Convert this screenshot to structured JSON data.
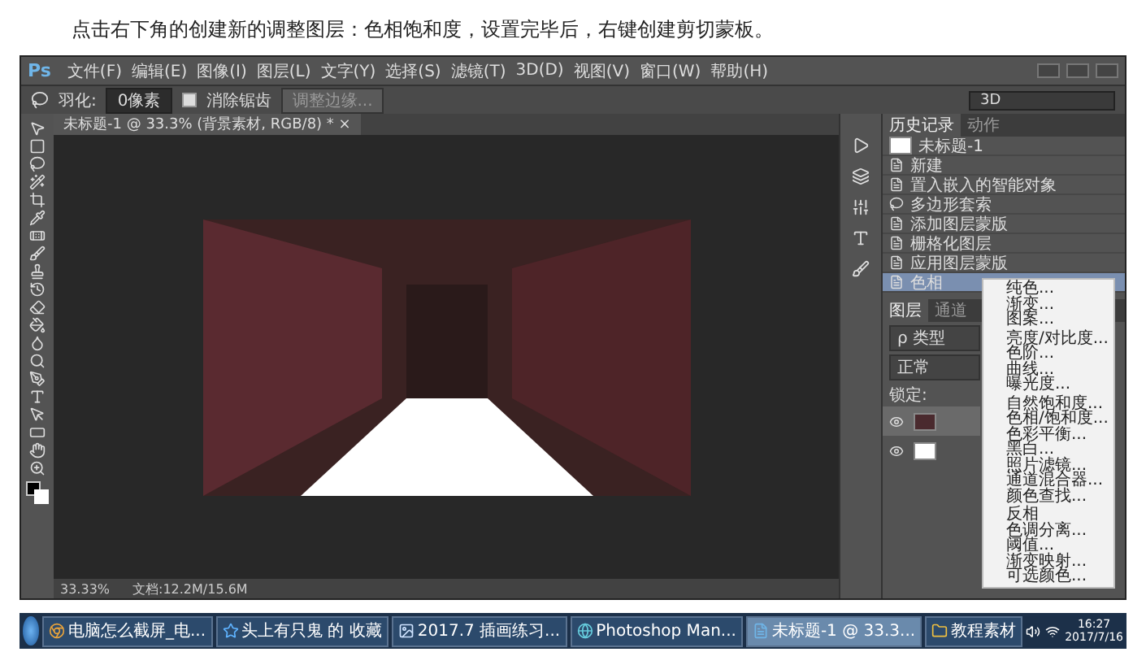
{
  "instruction": "点击右下角的创建新的调整图层：色相饱和度，设置完毕后，右键创建剪切蒙板。",
  "app": {
    "logo": "Ps",
    "menu": [
      "文件(F)",
      "编辑(E)",
      "图像(I)",
      "图层(L)",
      "文字(Y)",
      "选择(S)",
      "滤镜(T)",
      "3D(D)",
      "视图(V)",
      "窗口(W)",
      "帮助(H)"
    ]
  },
  "options_bar": {
    "feather_label": "羽化:",
    "feather_value": "0像素",
    "antialias": {
      "label": "消除锯齿",
      "checked": true
    },
    "refine_button": "调整边缘...",
    "workspace": "3D"
  },
  "document_tab": {
    "title": "未标题-1 @ 33.3% (背景素材, RGB/8) *",
    "close": "×"
  },
  "history_panel": {
    "tabs": [
      {
        "label": "历史记录",
        "selected": true
      },
      {
        "label": "动作",
        "selected": false
      }
    ],
    "items": [
      {
        "kind": "snapshot",
        "label": "未标题-1",
        "selected": false
      },
      {
        "kind": "step",
        "label": "新建",
        "selected": false
      },
      {
        "kind": "step",
        "label": "置入嵌入的智能对象",
        "selected": false
      },
      {
        "kind": "lasso",
        "label": "多边形套索",
        "selected": false
      },
      {
        "kind": "step",
        "label": "添加图层蒙版",
        "selected": false
      },
      {
        "kind": "step",
        "label": "栅格化图层",
        "selected": false
      },
      {
        "kind": "step",
        "label": "应用图层蒙版",
        "selected": false
      },
      {
        "kind": "step",
        "label": "色相",
        "selected": true
      }
    ]
  },
  "layers_panel": {
    "tabs": [
      {
        "label": "图层",
        "selected": true
      },
      {
        "label": "通道",
        "selected": false
      }
    ],
    "filter": "ρ 类型",
    "blend_mode": "正常",
    "lock_label": "锁定:",
    "layers": [
      {
        "kind": "image",
        "visible": true,
        "selected": true
      },
      {
        "kind": "white",
        "visible": true,
        "selected": false
      }
    ]
  },
  "context_menu": {
    "groups": [
      [
        "纯色...",
        "渐变...",
        "图案..."
      ],
      [
        "亮度/对比度...",
        "色阶...",
        "曲线...",
        "曝光度..."
      ],
      [
        "自然饱和度...",
        "色相/饱和度...",
        "色彩平衡...",
        "黑白...",
        "照片滤镜...",
        "通道混合器...",
        "颜色查找..."
      ],
      [
        "反相",
        "色调分离...",
        "阈值...",
        "渐变映射...",
        "可选颜色..."
      ]
    ]
  },
  "status_bar": {
    "zoom": "33.33%",
    "doc": "文档:12.2M/15.6M"
  },
  "taskbar": {
    "items": [
      {
        "kind": "browser",
        "label": "电脑怎么截屏_电...",
        "selected": false
      },
      {
        "kind": "star",
        "label": "头上有只鬼 的 收藏",
        "selected": false
      },
      {
        "kind": "image",
        "label": "2017.7 插画练习...",
        "selected": false
      },
      {
        "kind": "globe",
        "label": "Photoshop Man...",
        "selected": false
      },
      {
        "kind": "ps",
        "label": "未标题-1 @ 33.3...",
        "selected": true
      },
      {
        "kind": "folder",
        "label": "教程素材",
        "selected": false
      }
    ],
    "time": "16:27",
    "date": "2017/7/16"
  }
}
